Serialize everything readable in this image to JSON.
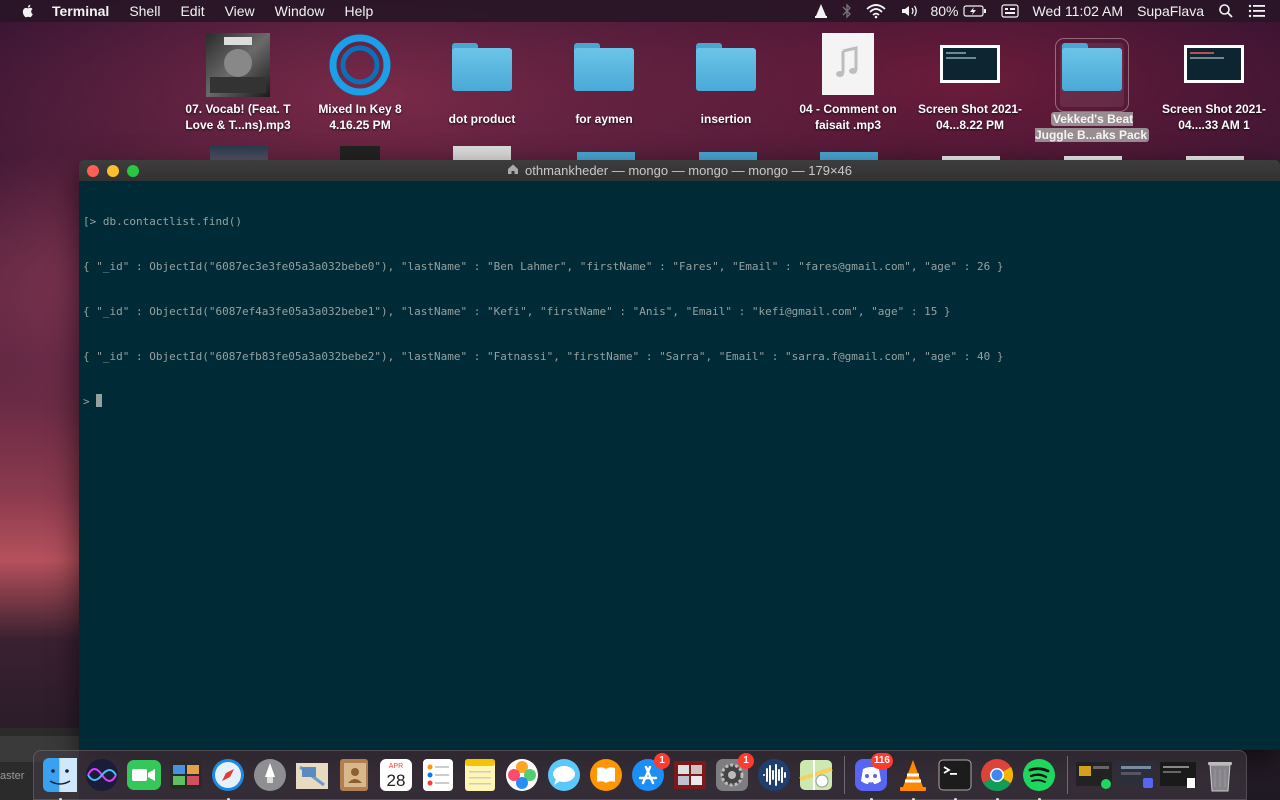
{
  "menubar": {
    "app_name": "Terminal",
    "items": [
      "Shell",
      "Edit",
      "View",
      "Window",
      "Help"
    ],
    "battery_pct": "80%",
    "clock": "Wed 11:02 AM",
    "user": "SupaFlava"
  },
  "desktop": {
    "icons": [
      {
        "label": "07. Vocab! (Feat. T Love & T...ns).mp3",
        "icon": "album-art-icon"
      },
      {
        "label": "Mixed In Key 8 4.16.25 PM",
        "icon": "cortana-ring-icon"
      },
      {
        "label": "dot product",
        "icon": "folder-icon"
      },
      {
        "label": "for aymen",
        "icon": "folder-icon"
      },
      {
        "label": "insertion",
        "icon": "folder-icon"
      },
      {
        "label": "04 - Comment on faisait .mp3",
        "icon": "music-file-icon"
      },
      {
        "label": "Screen Shot 2021-04...8.22 PM",
        "icon": "screenshot-icon"
      },
      {
        "label": "Vekked's Beat Juggle B...aks Pack",
        "icon": "folder-icon"
      },
      {
        "label": "Screen Shot 2021-04....33 AM 1",
        "icon": "screenshot-icon"
      }
    ]
  },
  "terminal": {
    "title": "othmankheder — mongo — mongo — mongo — 179×46",
    "lines": [
      "[> db.contactlist.find()",
      "{ \"_id\" : ObjectId(\"6087ec3e3fe05a3a032bebe0\"), \"lastName\" : \"Ben Lahmer\", \"firstName\" : \"Fares\", \"Email\" : \"fares@gmail.com\", \"age\" : 26 }",
      "{ \"_id\" : ObjectId(\"6087ef4a3fe05a3a032bebe1\"), \"lastName\" : \"Kefi\", \"firstName\" : \"Anis\", \"Email\" : \"kefi@gmail.com\", \"age\" : 15 }",
      "{ \"_id\" : ObjectId(\"6087efb83fe05a3a032bebe2\"), \"lastName\" : \"Fatnassi\", \"firstName\" : \"Sarra\", \"Email\" : \"sarra.f@gmail.com\", \"age\" : 40 }"
    ],
    "prompt": "> "
  },
  "background_window": {
    "text": "aster"
  },
  "dock": {
    "items": [
      {
        "name": "finder",
        "running": true
      },
      {
        "name": "siri",
        "running": false
      },
      {
        "name": "facetime",
        "running": false
      },
      {
        "name": "photo-booth",
        "running": false
      },
      {
        "name": "safari",
        "running": true
      },
      {
        "name": "launchpad",
        "running": false
      },
      {
        "name": "mail",
        "running": false
      },
      {
        "name": "contacts",
        "running": false
      },
      {
        "name": "calendar",
        "running": false,
        "month": "APR",
        "day": "28"
      },
      {
        "name": "reminders",
        "running": false
      },
      {
        "name": "notes",
        "running": false
      },
      {
        "name": "photos",
        "running": false
      },
      {
        "name": "messages",
        "running": false
      },
      {
        "name": "books",
        "running": false
      },
      {
        "name": "app-store",
        "running": false,
        "badge": "1"
      },
      {
        "name": "photo-app",
        "running": false
      },
      {
        "name": "system-preferences",
        "running": false,
        "badge": "1"
      },
      {
        "name": "audio-app",
        "running": false
      },
      {
        "name": "maps",
        "running": false
      },
      {
        "name": "discord",
        "running": true,
        "badge": "116"
      },
      {
        "name": "vlc",
        "running": true
      },
      {
        "name": "terminal",
        "running": true
      },
      {
        "name": "chrome",
        "running": true
      },
      {
        "name": "spotify",
        "running": true
      },
      {
        "name": "minimized-window-1",
        "running": false
      },
      {
        "name": "minimized-window-2",
        "running": false
      },
      {
        "name": "minimized-window-3",
        "running": false
      },
      {
        "name": "trash",
        "running": false
      }
    ]
  }
}
